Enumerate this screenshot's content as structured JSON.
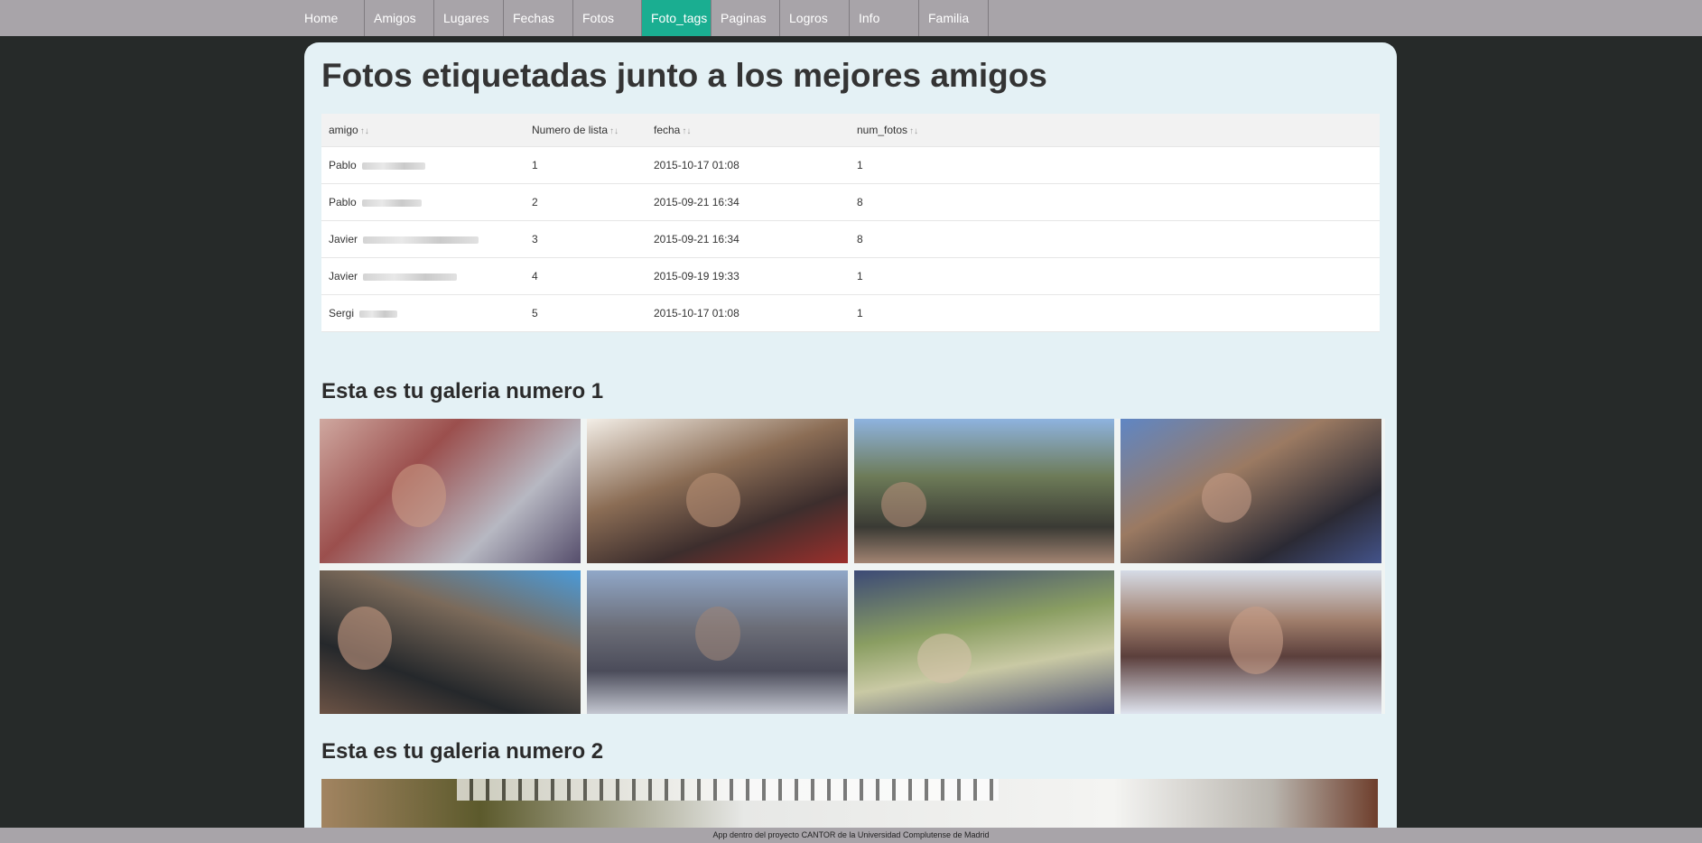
{
  "nav": {
    "items": [
      {
        "label": "Home",
        "active": false
      },
      {
        "label": "Amigos",
        "active": false
      },
      {
        "label": "Lugares",
        "active": false
      },
      {
        "label": "Fechas",
        "active": false
      },
      {
        "label": "Fotos",
        "active": false
      },
      {
        "label": "Foto_tags",
        "active": true
      },
      {
        "label": "Paginas",
        "active": false
      },
      {
        "label": "Logros",
        "active": false
      },
      {
        "label": "Info",
        "active": false
      },
      {
        "label": "Familia",
        "active": false
      }
    ]
  },
  "main": {
    "title": "Fotos etiquetadas junto a los mejores amigos",
    "table": {
      "headers": [
        "amigo",
        "Numero de lista",
        "fecha",
        "num_fotos"
      ],
      "sort_glyph": "↑↓",
      "rows": [
        {
          "amigo": "Pablo",
          "numero": "1",
          "fecha": "2015-10-17 01:08",
          "num_fotos": "1"
        },
        {
          "amigo": "Pablo",
          "numero": "2",
          "fecha": "2015-09-21 16:34",
          "num_fotos": "8"
        },
        {
          "amigo": "Javier",
          "numero": "3",
          "fecha": "2015-09-21 16:34",
          "num_fotos": "8"
        },
        {
          "amigo": "Javier",
          "numero": "4",
          "fecha": "2015-09-19 19:33",
          "num_fotos": "1"
        },
        {
          "amigo": "Sergi",
          "numero": "5",
          "fecha": "2015-10-17 01:08",
          "num_fotos": "1"
        }
      ]
    },
    "gallery1_title": "Esta es tu galeria numero 1",
    "gallery2_title": "Esta es tu galeria numero 2"
  },
  "footer": {
    "text": "App dentro del proyecto CANTOR de la Universidad Complutense de Madrid"
  },
  "colors": {
    "nav_bg": "#a8a4a9",
    "nav_active": "#1aae91",
    "page_bg": "#262a29",
    "panel_bg": "#e4f1f5"
  }
}
